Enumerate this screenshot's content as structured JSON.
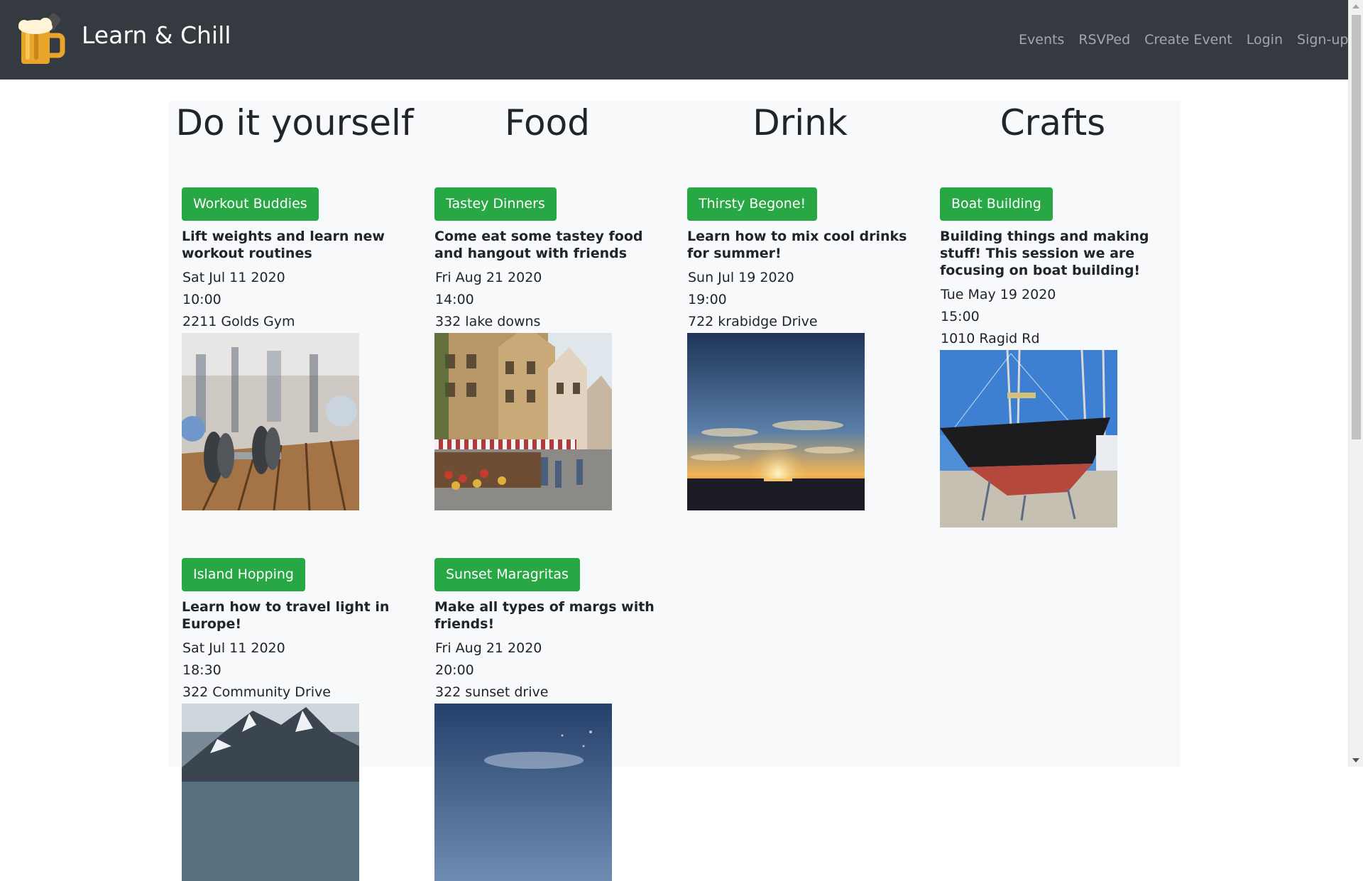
{
  "navbar": {
    "brand": "Learn & Chill",
    "links": [
      "Events",
      "RSVPed",
      "Create Event",
      "Login",
      "Sign-up"
    ]
  },
  "categories": [
    "Do it yourself",
    "Food",
    "Drink",
    "Crafts"
  ],
  "events": [
    {
      "button": "Workout Buddies",
      "description": "Lift weights and learn new workout routines",
      "date": "Sat Jul 11 2020",
      "time": "10:00",
      "location": "2211 Golds Gym",
      "image": "gym-dumbbell-image"
    },
    {
      "button": "Tastey Dinners",
      "description": "Come eat some tastey food and hangout with friends",
      "date": "Fri Aug 21 2020",
      "time": "14:00",
      "location": "332 lake downs",
      "image": "street-market-image"
    },
    {
      "button": "Thirsty Begone!",
      "description": "Learn how to mix cool drinks for summer!",
      "date": "Sun Jul 19 2020",
      "time": "19:00",
      "location": "722 krabidge Drive",
      "image": "sunset-sea-image"
    },
    {
      "button": "Boat Building",
      "description": "Building things and making stuff! This session we are focusing on boat building!",
      "date": "Tue May 19 2020",
      "time": "15:00",
      "location": "1010 Ragid Rd",
      "image": "sailboat-dry-dock-image"
    },
    {
      "button": "Island Hopping",
      "description": "Learn how to travel light in Europe!",
      "date": "Sat Jul 11 2020",
      "time": "18:30",
      "location": "322 Community Drive",
      "image": "snowy-mountain-image"
    },
    {
      "button": "Sunset Maragritas",
      "description": "Make all types of margs with friends!",
      "date": "Fri Aug 21 2020",
      "time": "20:00",
      "location": "322 sunset drive",
      "image": "evening-sky-image"
    }
  ]
}
